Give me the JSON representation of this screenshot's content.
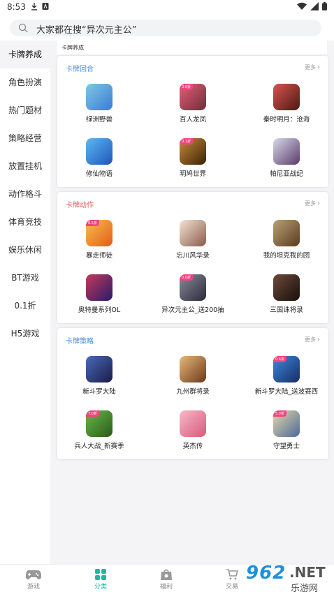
{
  "status_bar": {
    "time": "8:53"
  },
  "search": {
    "text": "大家都在搜“异次元主公”"
  },
  "sidebar": {
    "items": [
      {
        "label": "卡牌养成",
        "active": true
      },
      {
        "label": "角色扮演"
      },
      {
        "label": "热门题材"
      },
      {
        "label": "策略经营"
      },
      {
        "label": "放置挂机"
      },
      {
        "label": "动作格斗"
      },
      {
        "label": "体育竞技"
      },
      {
        "label": "娱乐休闲"
      },
      {
        "label": "BT游戏"
      },
      {
        "label": "0.1折"
      },
      {
        "label": "H5游戏"
      }
    ]
  },
  "content": {
    "section_title": "卡牌养成",
    "more_label": "更多",
    "cards": [
      {
        "title": "卡牌回合",
        "title_color": "#4a90e2",
        "games": [
          {
            "name": "绿洲野兽",
            "badge": "",
            "colors": [
              "#7ec8e3",
              "#3a7bd5"
            ]
          },
          {
            "name": "百人龙凤",
            "badge": "3.0折",
            "colors": [
              "#e85d75",
              "#6b2f3a"
            ]
          },
          {
            "name": "秦时明月：沧海",
            "badge": "",
            "colors": [
              "#d9534f",
              "#4a1a12"
            ]
          },
          {
            "name": "修仙物语",
            "badge": "",
            "colors": [
              "#5bb8f5",
              "#2056b8"
            ]
          },
          {
            "name": "玥鸠世界",
            "badge": "0.1折",
            "colors": [
              "#c98a3a",
              "#3b2208"
            ]
          },
          {
            "name": "帕尼亚战纪",
            "badge": "",
            "colors": [
              "#d8d8e8",
              "#5a3a6a"
            ]
          }
        ]
      },
      {
        "title": "卡牌动作",
        "title_color": "#e85d5d",
        "games": [
          {
            "name": "暴走师徒",
            "badge": "0.5折",
            "colors": [
              "#f7c04a",
              "#e25b1b"
            ]
          },
          {
            "name": "忘川风华录",
            "badge": "",
            "colors": [
              "#f4e4d4",
              "#8a5a4a"
            ]
          },
          {
            "name": "我的坦克我的团",
            "badge": "",
            "colors": [
              "#b8a27a",
              "#5a3a1a"
            ]
          },
          {
            "name": "奥特曼系列OL",
            "badge": "",
            "colors": [
              "#c43a5a",
              "#2a1a6a"
            ]
          },
          {
            "name": "异次元主公_送200抽",
            "badge": "0.0折",
            "colors": [
              "#8a8a9a",
              "#2a2a3a"
            ]
          },
          {
            "name": "三国诛将录",
            "badge": "",
            "colors": [
              "#6a4a3a",
              "#1a0e0a"
            ]
          }
        ]
      },
      {
        "title": "卡牌策略",
        "title_color": "#4a90e2",
        "games": [
          {
            "name": "新斗罗大陆",
            "badge": "",
            "colors": [
              "#4a6ab8",
              "#1a1a4a"
            ]
          },
          {
            "name": "九州群将录",
            "badge": "",
            "colors": [
              "#e8b87a",
              "#6a3a1a"
            ]
          },
          {
            "name": "新斗罗大陆_送波赛西",
            "badge": "0.4折",
            "colors": [
              "#3a8ad8",
              "#1a2a6a"
            ]
          },
          {
            "name": "兵人大战_新赛季",
            "badge": "7.0折",
            "colors": [
              "#6ab84a",
              "#2a5a1a"
            ]
          },
          {
            "name": "英杰传",
            "badge": "",
            "colors": [
              "#f8b8c8",
              "#d85a7a"
            ]
          },
          {
            "name": "守望勇士",
            "badge": "5.0折",
            "colors": [
              "#e8d8a8",
              "#4a6a9a"
            ]
          }
        ]
      }
    ]
  },
  "bottom_nav": {
    "items": [
      {
        "label": "游戏"
      },
      {
        "label": "分类",
        "active": true
      },
      {
        "label": "福利"
      },
      {
        "label": "交易"
      }
    ]
  },
  "watermark": {
    "number": "962",
    "net": ".NET",
    "site": "乐游网"
  }
}
